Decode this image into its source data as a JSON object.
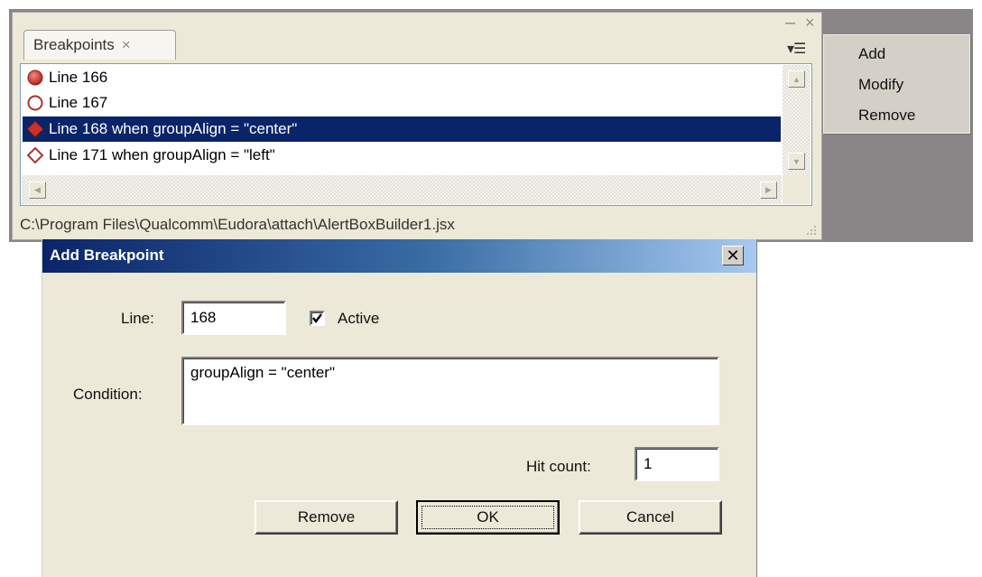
{
  "breakpoints_panel": {
    "tab_label": "Breakpoints",
    "tab_close_glyph": "×",
    "minimize_glyph": "–",
    "close_glyph": "×",
    "menu_glyph": "▾☰",
    "items": [
      {
        "label": "Line 166",
        "icon": "filled-circle-breakpoint-icon",
        "selected": false
      },
      {
        "label": "Line 167",
        "icon": "hollow-circle-breakpoint-icon",
        "selected": false
      },
      {
        "label": "Line 168 when groupAlign = \"center\"",
        "icon": "filled-diamond-breakpoint-icon",
        "selected": true
      },
      {
        "label": "Line 171 when groupAlign = \"left\"",
        "icon": "hollow-diamond-breakpoint-icon",
        "selected": false
      }
    ],
    "status_path": "C:\\Program Files\\Qualcomm\\Eudora\\attach\\AlertBoxBuilder1.jsx"
  },
  "context_menu": {
    "items": [
      "Add",
      "Modify",
      "Remove"
    ]
  },
  "dialog": {
    "title": "Add Breakpoint",
    "close_glyph": "✕",
    "line_label": "Line:",
    "line_value": "168",
    "active_label": "Active",
    "active_checked": true,
    "condition_label": "Condition:",
    "condition_value": "groupAlign = \"center\"",
    "hit_count_label": "Hit count:",
    "hit_count_value": "1",
    "buttons": {
      "remove": "Remove",
      "ok": "OK",
      "cancel": "Cancel"
    }
  },
  "colors": {
    "selection": "#0a246a",
    "breakpoint_red": "#c8312c",
    "dialog_title_start": "#0a246a",
    "dialog_title_end": "#a6caf0"
  }
}
